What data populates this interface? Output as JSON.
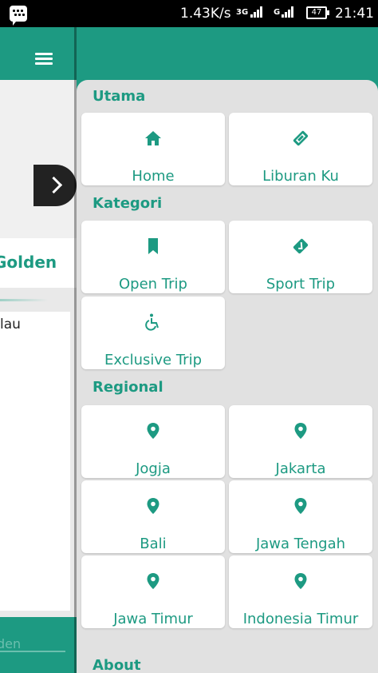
{
  "status_bar": {
    "net_speed": "1.43K/s",
    "network_1": "3G",
    "network_2": "G",
    "battery": "47",
    "time": "21:41"
  },
  "background_page": {
    "title_fragment": "Golden",
    "list_text_fragment": "lau",
    "search_placeholder_fragment": "den"
  },
  "drawer": {
    "sections": [
      {
        "title": "Utama",
        "items": [
          {
            "label": "Home",
            "icon": "home-icon"
          },
          {
            "label": "Liburan Ku",
            "icon": "ticket-icon"
          }
        ]
      },
      {
        "title": "Kategori",
        "items": [
          {
            "label": "Open Trip",
            "icon": "bookmark-icon"
          },
          {
            "label": "Sport Trip",
            "icon": "badge-check-icon"
          },
          {
            "label": "Exclusive Trip",
            "icon": "wheelchair-icon"
          }
        ]
      },
      {
        "title": "Regional",
        "items": [
          {
            "label": "Jogja",
            "icon": "location-pin-icon"
          },
          {
            "label": "Jakarta",
            "icon": "location-pin-icon"
          },
          {
            "label": "Bali",
            "icon": "location-pin-icon"
          },
          {
            "label": "Jawa Tengah",
            "icon": "location-pin-icon"
          },
          {
            "label": "Jawa Timur",
            "icon": "location-pin-icon"
          },
          {
            "label": "Indonesia Timur",
            "icon": "location-pin-icon"
          }
        ]
      },
      {
        "title": "About",
        "items": []
      }
    ]
  },
  "colors": {
    "primary": "#1d9a82",
    "drawer_bg": "#e1e1e1",
    "tile_bg": "#ffffff"
  }
}
